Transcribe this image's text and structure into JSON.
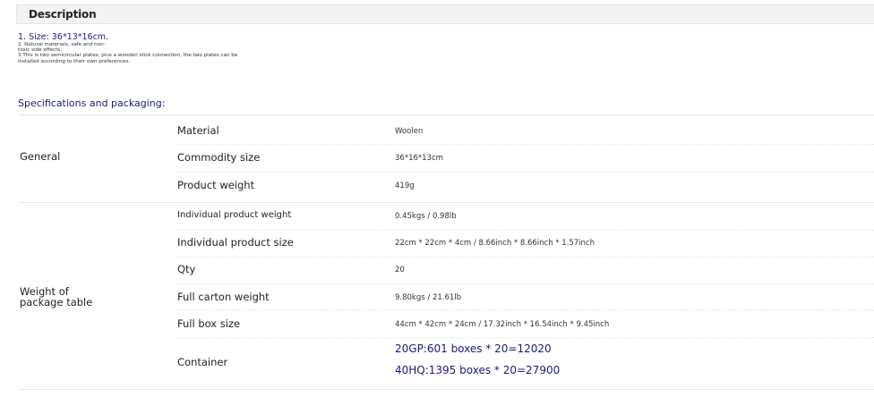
{
  "description": {
    "title": "Description",
    "line1": "1. Size: 36*13*16cm.",
    "line2a": "2. Natural materials, safe and non-",
    "line2b": "toxic side effects.",
    "line3a": "3.This is two semicircular plates, plus a wooden stick connection, the two plates can be",
    "line3b": "installed according to their own preferences."
  },
  "specs": {
    "heading": "Specifications and packaging:",
    "general": {
      "label": "General",
      "rows": [
        {
          "label": "Material",
          "value": "Woolen"
        },
        {
          "label": "Commodity size",
          "value": "36*16*13cm"
        },
        {
          "label": "Product weight",
          "value": "419g"
        }
      ]
    },
    "package": {
      "label_line1": "Weight of",
      "label_line2": "package table",
      "rows": [
        {
          "label": "Individual product weight",
          "value": "0.45kgs / 0.98lb"
        },
        {
          "label": "Individual product size",
          "value": "22cm * 22cm * 4cm / 8.66inch * 8.66inch * 1.57inch"
        },
        {
          "label": "Qty",
          "value": "20"
        },
        {
          "label": "Full carton weight",
          "value": "9.80kgs / 21.61lb"
        },
        {
          "label": "Full box size",
          "value": "44cm * 42cm * 24cm / 17.32inch * 16.54inch * 9.45inch"
        }
      ],
      "container": {
        "label": "Container",
        "value1": "20GP:601 boxes * 20=12020",
        "value2": "40HQ:1395 boxes * 20=27900"
      }
    }
  }
}
